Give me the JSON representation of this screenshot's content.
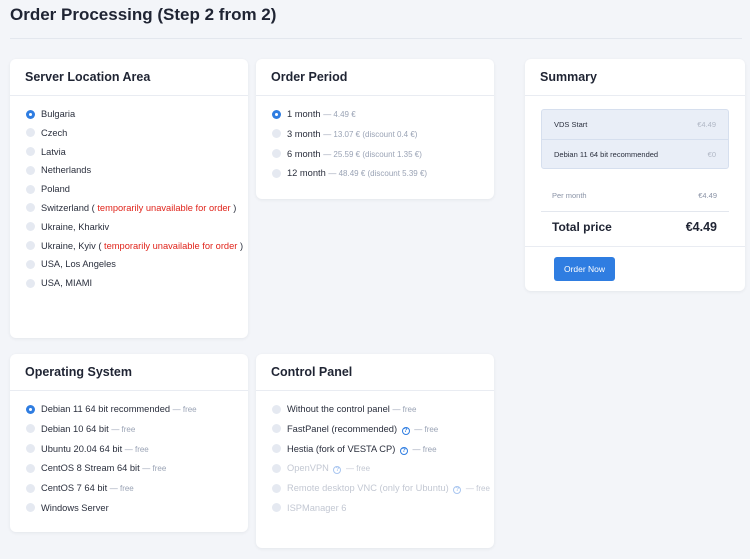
{
  "page": {
    "title": "Order Processing (Step 2 from 2)"
  },
  "location": {
    "title": "Server Location Area",
    "options": [
      {
        "label": "Bulgaria",
        "selected": true
      },
      {
        "label": "Czech"
      },
      {
        "label": "Latvia"
      },
      {
        "label": "Netherlands"
      },
      {
        "label": "Poland"
      },
      {
        "label": "Switzerland (",
        "warn": "temporarily unavailable for order",
        "after": ")"
      },
      {
        "label": "Ukraine, Kharkiv"
      },
      {
        "label": "Ukraine, Kyiv (",
        "warn": "temporarily unavailable for order",
        "after": ")"
      },
      {
        "label": "USA, Los Angeles"
      },
      {
        "label": "USA, MIAMI"
      }
    ]
  },
  "period": {
    "title": "Order Period",
    "options": [
      {
        "label": "1 month",
        "note": "— 4.49 €",
        "selected": true
      },
      {
        "label": "3 month",
        "note": "— 13.07 € (discount 0.4 €)"
      },
      {
        "label": "6 month",
        "note": "— 25.59 € (discount 1.35 €)"
      },
      {
        "label": "12 month",
        "note": "— 48.49 € (discount 5.39 €)"
      }
    ]
  },
  "os": {
    "title": "Operating System",
    "options": [
      {
        "label": "Debian 11 64 bit recommended",
        "note": "— free",
        "selected": true
      },
      {
        "label": "Debian 10 64 bit",
        "note": "— free"
      },
      {
        "label": "Ubuntu 20.04 64 bit",
        "note": "— free"
      },
      {
        "label": "CentOS 8 Stream 64 bit",
        "note": "— free"
      },
      {
        "label": "CentOS 7 64 bit",
        "note": "— free"
      },
      {
        "label": "Windows Server"
      }
    ]
  },
  "panel": {
    "title": "Control Panel",
    "options": [
      {
        "label": "Without the control panel",
        "note": "— free"
      },
      {
        "label": "FastPanel (recommended)",
        "help": "?",
        "note": "— free"
      },
      {
        "label": "Hestia (fork of VESTA CP)",
        "help": "?",
        "note": "— free"
      },
      {
        "label": "OpenVPN",
        "help": "?",
        "note": "— free",
        "disabled": true
      },
      {
        "label": "Remote desktop VNC (only for Ubuntu)",
        "help": "?",
        "note": "— free",
        "disabled": true
      },
      {
        "label": "ISPManager 6",
        "disabled": true
      }
    ]
  },
  "summary": {
    "title": "Summary",
    "items": [
      {
        "label": "VDS Start",
        "price": "€4.49"
      },
      {
        "label": "Debian 11 64 bit recommended",
        "price": "€0"
      }
    ],
    "per_month_label": "Per month",
    "per_month_value": "€4.49",
    "total_label": "Total price",
    "total_value": "€4.49",
    "order_button": "Order Now"
  },
  "colors": {
    "accent": "#2f7de1",
    "warning": "#e0241b",
    "muted": "#9aa3b5",
    "background": "#f3f5f9"
  }
}
